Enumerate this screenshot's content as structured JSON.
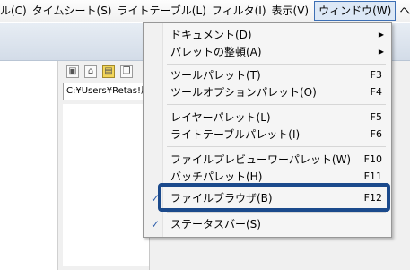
{
  "menubar": [
    {
      "label": "ル(C)"
    },
    {
      "label": "タイムシート(S)"
    },
    {
      "label": "ライトテーブル(L)"
    },
    {
      "label": "フィルタ(I)"
    },
    {
      "label": "表示(V)"
    },
    {
      "label": "ウィンドウ(W)"
    },
    {
      "label": "ヘ"
    }
  ],
  "path_field": {
    "value": "C:¥Users¥Retas!用"
  },
  "window_menu": {
    "items": [
      {
        "label": "ドキュメント(D)",
        "shortcut": "",
        "submenu_arrow": "▶",
        "checked": ""
      },
      {
        "label": "パレットの整頓(A)",
        "shortcut": "",
        "submenu_arrow": "▶",
        "checked": ""
      },
      {
        "label": "ツールパレット(T)",
        "shortcut": "F3",
        "submenu_arrow": "",
        "checked": ""
      },
      {
        "label": "ツールオプションパレット(O)",
        "shortcut": "F4",
        "submenu_arrow": "",
        "checked": ""
      },
      {
        "label": "レイヤーパレット(L)",
        "shortcut": "F5",
        "submenu_arrow": "",
        "checked": ""
      },
      {
        "label": "ライトテーブルパレット(I)",
        "shortcut": "F6",
        "submenu_arrow": "",
        "checked": ""
      },
      {
        "label": "ファイルプレビューワーパレット(W)",
        "shortcut": "F10",
        "submenu_arrow": "",
        "checked": ""
      },
      {
        "label": "バッチパレット(H)",
        "shortcut": "F11",
        "submenu_arrow": "",
        "checked": ""
      },
      {
        "label": "ファイルブラウザ(B)",
        "shortcut": "F12",
        "submenu_arrow": "",
        "checked": "✓"
      },
      {
        "label": "ステータスバー(S)",
        "shortcut": "",
        "submenu_arrow": "",
        "checked": "✓"
      }
    ]
  },
  "colors": {
    "highlight_border": "#1b4a8c",
    "check": "#2a5caa"
  }
}
